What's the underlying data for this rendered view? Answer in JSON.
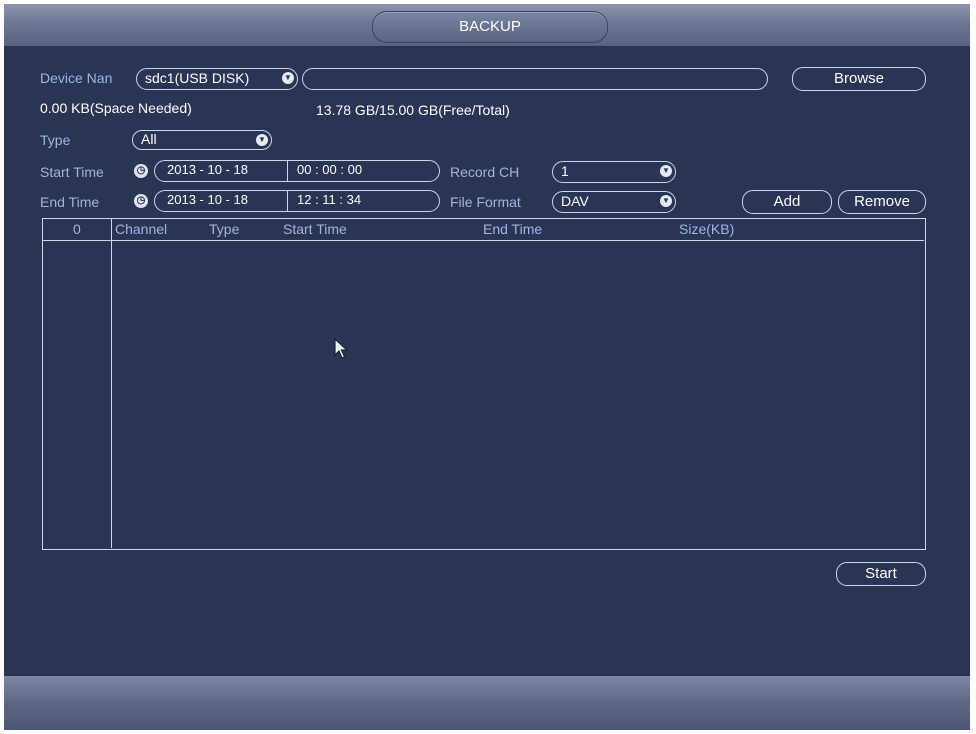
{
  "window": {
    "title": "BACKUP"
  },
  "device": {
    "label": "Device Nan",
    "selected": "sdc1(USB DISK)",
    "path_value": "",
    "browse_label": "Browse",
    "space_needed": "0.00 KB(Space Needed)",
    "free_total": "13.78 GB/15.00 GB(Free/Total)"
  },
  "filters": {
    "type_label": "Type",
    "type_value": "All",
    "start_time_label": "Start Time",
    "start_date": "2013 - 10 - 18",
    "start_clock": "00 : 00 : 00",
    "end_time_label": "End Time",
    "end_date": "2013 - 10 - 18",
    "end_clock": "12 : 11 : 34",
    "record_ch_label": "Record CH",
    "record_ch_value": "1",
    "file_format_label": "File Format",
    "file_format_value": "DAV",
    "add_label": "Add",
    "remove_label": "Remove"
  },
  "table": {
    "count": "0",
    "columns": [
      "Channel",
      "Type",
      "Start Time",
      "End Time",
      "Size(KB)"
    ],
    "rows": []
  },
  "actions": {
    "start_label": "Start"
  },
  "icons": {
    "dropdown": "chevron-down-icon",
    "time": "clock-icon",
    "pointer": "mouse-pointer-icon"
  },
  "colors": {
    "background": "#2b3452",
    "label": "#9fb5e3",
    "text": "#ffffff",
    "border": "#cfd6e8"
  }
}
